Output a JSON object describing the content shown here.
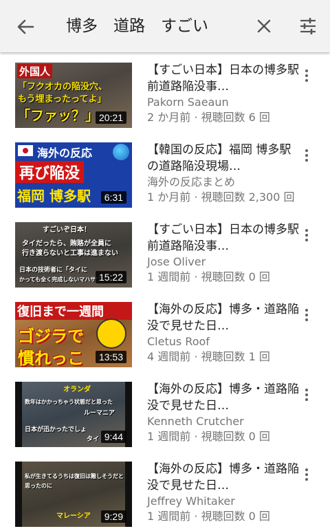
{
  "search": {
    "query": "博多　道路　すごい"
  },
  "results": [
    {
      "title": "【すごい日本】日本の博多駅前道路陥没事…",
      "channel": "Pakorn Saeaun",
      "stats": "2 か月前 · 視聴回数 6 回",
      "duration": "20:21",
      "thumb_text": [
        "外国人",
        "「フクオカの陥没穴、",
        "もう埋まったってよ」",
        "「ファッ？」"
      ],
      "colors": {
        "bg": "#5a5047"
      }
    },
    {
      "title": "【韓国の反応】福岡 博多駅の道路陥没現場…",
      "channel": "海外の反応まとめ",
      "stats": "1 か月前 · 視聴回数 2,300 回",
      "duration": "6:31",
      "thumb_text": [
        "海外の反応",
        "再び陥没",
        "福岡 博多駅"
      ],
      "colors": {
        "bg": "#1740a8"
      }
    },
    {
      "title": "【すごい日本】日本の博多駅前道路陥没事…",
      "channel": "Jose Oliver",
      "stats": "1 週間前 · 視聴回数 0 回",
      "duration": "15:22",
      "thumb_text": [
        "すごいぞ日本！",
        "タイだったら、賄賂が全員に",
        "行き渡らないと工事は進まない",
        "日本の技術者に「タイに",
        "かっても全く完成しないマハサワ"
      ],
      "colors": {
        "bg": "#4d4a45"
      }
    },
    {
      "title": "【海外の反応】博多・道路陥没で見せた日…",
      "channel": "Cletus Roof",
      "stats": "4 週間前 · 視聴回数 1 回",
      "duration": "13:53",
      "thumb_text": [
        "復旧まで一週間",
        "ゴジラで",
        "慣れっこ"
      ],
      "colors": {
        "bg": "#a8703a"
      }
    },
    {
      "title": "【海外の反応】博多・道路陥没で見せた日…",
      "channel": "Kenneth Crutcher",
      "stats": "1 週間前 · 視聴回数 0 回",
      "duration": "9:44",
      "thumb_text": [
        "オランダ",
        "数年はかかっちゃう状態だと思った",
        "ルーマニア",
        "日本が迅かったでしょ",
        "タイ"
      ],
      "colors": {
        "bg": "#3f4a55"
      }
    },
    {
      "title": "【海外の反応】博多・道路陥没で見せた日…",
      "channel": "Jeffrey Whitaker",
      "stats": "1 週間前 · 視聴回数 0 回",
      "duration": "9:29",
      "thumb_text": [
        "私が生きてるうちは復旧は難しそうだと",
        "思ったのに",
        "マレーシア"
      ],
      "colors": {
        "bg": "#4a4438"
      }
    }
  ]
}
